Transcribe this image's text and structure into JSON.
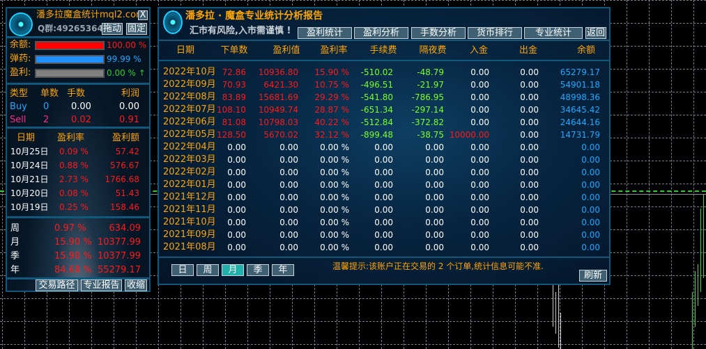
{
  "left_panel": {
    "title": "潘多拉魔盒统计",
    "site": "mql2.com",
    "close": "X",
    "qq": "Q群:492653640",
    "drag": "拖动",
    "fix": "固定",
    "bars": [
      {
        "label": "余额:",
        "value": "100.00 %",
        "fill": 1.0,
        "color": "#ff0000"
      },
      {
        "label": "弹药:",
        "value": "99.99 %",
        "fill": 0.9999,
        "color": "#1e90ff"
      },
      {
        "label": "盈利:",
        "value": "0.00 % ↑",
        "fill": 1.0,
        "color": "#808080"
      }
    ],
    "type_header": [
      "类型",
      "单数",
      "手数",
      "利润"
    ],
    "types": [
      [
        "Buy",
        "0",
        "0.00",
        "0.00"
      ],
      [
        "Sell",
        "2",
        "0.02",
        "0.91"
      ]
    ],
    "daily_header": [
      "日期",
      "盈利率",
      "盈利额"
    ],
    "daily": [
      [
        "10月25日",
        "0.09 %",
        "57.42"
      ],
      [
        "10月24日",
        "0.88 %",
        "576.67"
      ],
      [
        "10月21日",
        "2.73 %",
        "1766.68"
      ],
      [
        "10月20日",
        "0.08 %",
        "51.43"
      ],
      [
        "10月19日",
        "0.25 %",
        "158.46"
      ]
    ],
    "periods": [
      [
        "周",
        "0.97 %",
        "634.09"
      ],
      [
        "月",
        "15.90 %",
        "10377.99"
      ],
      [
        "季",
        "15.90 %",
        "10377.99"
      ],
      [
        "年",
        "84.68 %",
        "55279.17"
      ]
    ],
    "buttons": [
      "交易路径",
      "专业报告",
      "收缩"
    ]
  },
  "report": {
    "title": "潘多拉 · 魔盒专业统计分析报告",
    "warning": "汇市有风险,入市需谨慎 !",
    "tabs": [
      "盈利统计",
      "盈利分析",
      "手数分析",
      "货币排行",
      "专业统计"
    ],
    "back": "返回",
    "headers": [
      "日期",
      "下单数",
      "盈利值",
      "盈利率",
      "手续费",
      "隔夜费",
      "入金",
      "出金",
      "余额"
    ],
    "rows": [
      [
        "2022年10月",
        "72.86",
        "10936.80",
        "15.90 %",
        "-510.02",
        "-48.79",
        "0.00",
        "0.00",
        "65279.17"
      ],
      [
        "2022年09月",
        "70.93",
        "6421.30",
        "10.75 %",
        "-496.51",
        "-21.97",
        "0.00",
        "0.00",
        "54901.18"
      ],
      [
        "2022年08月",
        "83.89",
        "15681.69",
        "29.29 %",
        "-541.80",
        "-786.95",
        "0.00",
        "0.00",
        "48998.36"
      ],
      [
        "2022年07月",
        "108.10",
        "10949.74",
        "28.87 %",
        "-651.34",
        "-297.14",
        "0.00",
        "0.00",
        "34645.42"
      ],
      [
        "2022年06月",
        "81.08",
        "10798.03",
        "40.22 %",
        "-512.84",
        "-372.82",
        "0.00",
        "0.00",
        "24644.16"
      ],
      [
        "2022年05月",
        "128.50",
        "5670.02",
        "32.12 %",
        "-899.48",
        "-38.75",
        "10000.00",
        "0.00",
        "14731.79"
      ],
      [
        "2022年04月",
        "0.00",
        "0.00",
        "0.00 %",
        "0.00",
        "0.00",
        "0.00",
        "0.00",
        "0.00"
      ],
      [
        "2022年03月",
        "0.00",
        "0.00",
        "0.00 %",
        "0.00",
        "0.00",
        "0.00",
        "0.00",
        "0.00"
      ],
      [
        "2022年02月",
        "0.00",
        "0.00",
        "0.00 %",
        "0.00",
        "0.00",
        "0.00",
        "0.00",
        "0.00"
      ],
      [
        "2022年01月",
        "0.00",
        "0.00",
        "0.00 %",
        "0.00",
        "0.00",
        "0.00",
        "0.00",
        "0.00"
      ],
      [
        "2021年12月",
        "0.00",
        "0.00",
        "0.00 %",
        "0.00",
        "0.00",
        "0.00",
        "0.00",
        "0.00"
      ],
      [
        "2021年11月",
        "0.00",
        "0.00",
        "0.00 %",
        "0.00",
        "0.00",
        "0.00",
        "0.00",
        "0.00"
      ],
      [
        "2021年10月",
        "0.00",
        "0.00",
        "0.00 %",
        "0.00",
        "0.00",
        "0.00",
        "0.00",
        "0.00"
      ],
      [
        "2021年09月",
        "0.00",
        "0.00",
        "0.00 %",
        "0.00",
        "0.00",
        "0.00",
        "0.00",
        "0.00"
      ],
      [
        "2021年08月",
        "0.00",
        "0.00",
        "0.00 %",
        "0.00",
        "0.00",
        "0.00",
        "0.00",
        "0.00"
      ]
    ],
    "periods": [
      "日",
      "周",
      "月",
      "季",
      "年"
    ],
    "active_period": "月",
    "notice": "温馨提示:该账户正在交易的 2 个订单,统计信息可能不准.",
    "refresh": "刷新"
  }
}
